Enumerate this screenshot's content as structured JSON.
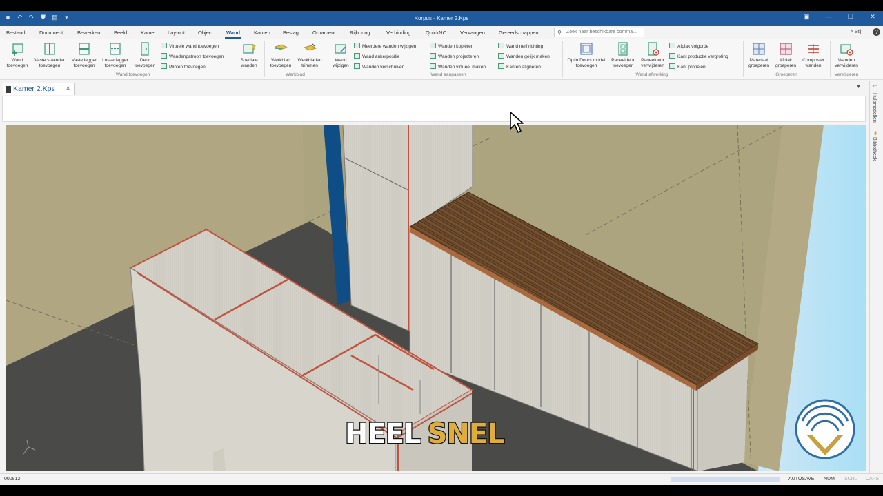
{
  "window": {
    "title": "Korpus - Kamer 2.Kps"
  },
  "menu": {
    "tabs": [
      "Bestand",
      "Document",
      "Bewerken",
      "Beeld",
      "Kamer",
      "Lay-out",
      "Object",
      "Wand",
      "Kanten",
      "Beslag",
      "Ornament",
      "Rijboring",
      "Verbinding",
      "QuickNC",
      "Vervangen",
      "Gereedschappen"
    ],
    "active": "Wand",
    "search_placeholder": "Zoek naar beschikbare comma...",
    "stijl": "Stijl"
  },
  "ribbon": {
    "buttons": {
      "wand_toevoegen": "Wand toevoegen",
      "vaste_staander": "Vaste staander toevoegen",
      "vaste_legger": "Vaste legger toevoegen",
      "losse_legger": "Losse legger toevoegen",
      "deur": "Deur toevoegen",
      "speciale_wanden": "Speciale wanden",
      "werkblad_toevoegen": "Werkblad toevoegen",
      "werkbladen_trimmen": "Werkbladen trimmen",
      "wand_wijzigen": "Wand wijzigen",
      "optimdoors": "OptimDoors model toevoegen",
      "paneeldeur_toevoegen": "Paneeldeur toevoegen",
      "paneeldeur_verwijderen": "Paneeldeur verwijderen",
      "materiaal_groeperen": "Materiaal groeperen",
      "afplak_groeperen": "Afplak groeperen",
      "composiet_wanden": "Composiet wanden",
      "wanden_verwijderen": "Wanden verwijderen"
    },
    "small": {
      "virtuele_wand": "Virtuele wand toevoegen",
      "wandenpatroon": "Wandenpatroon toevoegen",
      "plinten": "Plinten toevoegen",
      "meerdere_wanden": "Meerdere wanden wijzigen",
      "wand_ankerpositie": "Wand ankerpositie",
      "wanden_verschuiven": "Wanden verschuiven",
      "wanden_kopieren": "Wanden kopiëren",
      "wanden_projecteren": "Wanden projecteren",
      "wanden_virtueel": "Wanden virtueel maken",
      "wand_nerf": "Wand nerf richting",
      "wanden_gelijk": "Wanden gelijk maken",
      "kanten_aligneren": "Kanten aligneren",
      "afplak_volgorde": "Afplak volgorde",
      "kant_productie": "Kant productie vergroting",
      "kant_profielen": "Kant profielen"
    },
    "groups": {
      "wand_toevoegen": "Wand toevoegen",
      "werkblad": "Werkblad",
      "wand_aanpassen": "Wand aanpassen",
      "wand_afwerking": "Wand afwerking",
      "groeperen": "Groeperen",
      "verwijderen": "Verwijderen"
    }
  },
  "document_tab": {
    "label": "Kamer 2.Kps"
  },
  "side_panel": {
    "hulpmodellen": "Hulpmodellen",
    "bibliotheek": "Bibliotheek"
  },
  "viewport": {
    "caption_white": "HEEL",
    "caption_gold": "SNEL"
  },
  "status": {
    "code": "000812",
    "autosave": "AUTOSAVE",
    "num": "NUM",
    "scrl": "SCRL",
    "caps": "CAPS"
  },
  "colors": {
    "accent": "#1f5a9c",
    "caption_gold": "#e0ad3a",
    "edge_red": "#c0523e",
    "wood": "#6b4a2a",
    "panel": "#d5d2c8"
  }
}
